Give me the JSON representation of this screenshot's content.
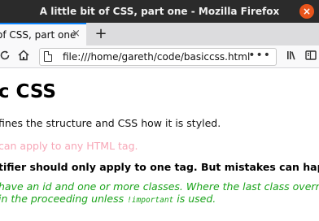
{
  "window": {
    "title": "A little bit of CSS, part one - Mozilla Firefox",
    "close_glyph": "×"
  },
  "tabstrip": {
    "active_tab_label": "of CSS, part one",
    "tab_close_glyph": "×",
    "new_tab_glyph": "+"
  },
  "toolbar": {
    "reload_icon": "reload-icon",
    "home_icon": "home-icon",
    "url": "file:///home/gareth/code/basiccss.html",
    "page_actions": "•••",
    "library_icon": "library-icon",
    "sidebar_icon": "sidebar-icon"
  },
  "page": {
    "heading": "ic CSS",
    "line1": "fines the structure and CSS how it is styled.",
    "line2": "can apply to any HTML tag.",
    "line3": "tifier should only apply to one tag. But mistakes can happ",
    "line4a": " have an id and one or more classes. Where the last class overri",
    "line4b_pre": "in the proceeding unless ",
    "line4b_code": "!important",
    "line4b_post": " is used."
  },
  "colors": {
    "line2": "#f7a7b7",
    "line4": "#1aa31a",
    "tab_accent": "#0a84ff"
  }
}
